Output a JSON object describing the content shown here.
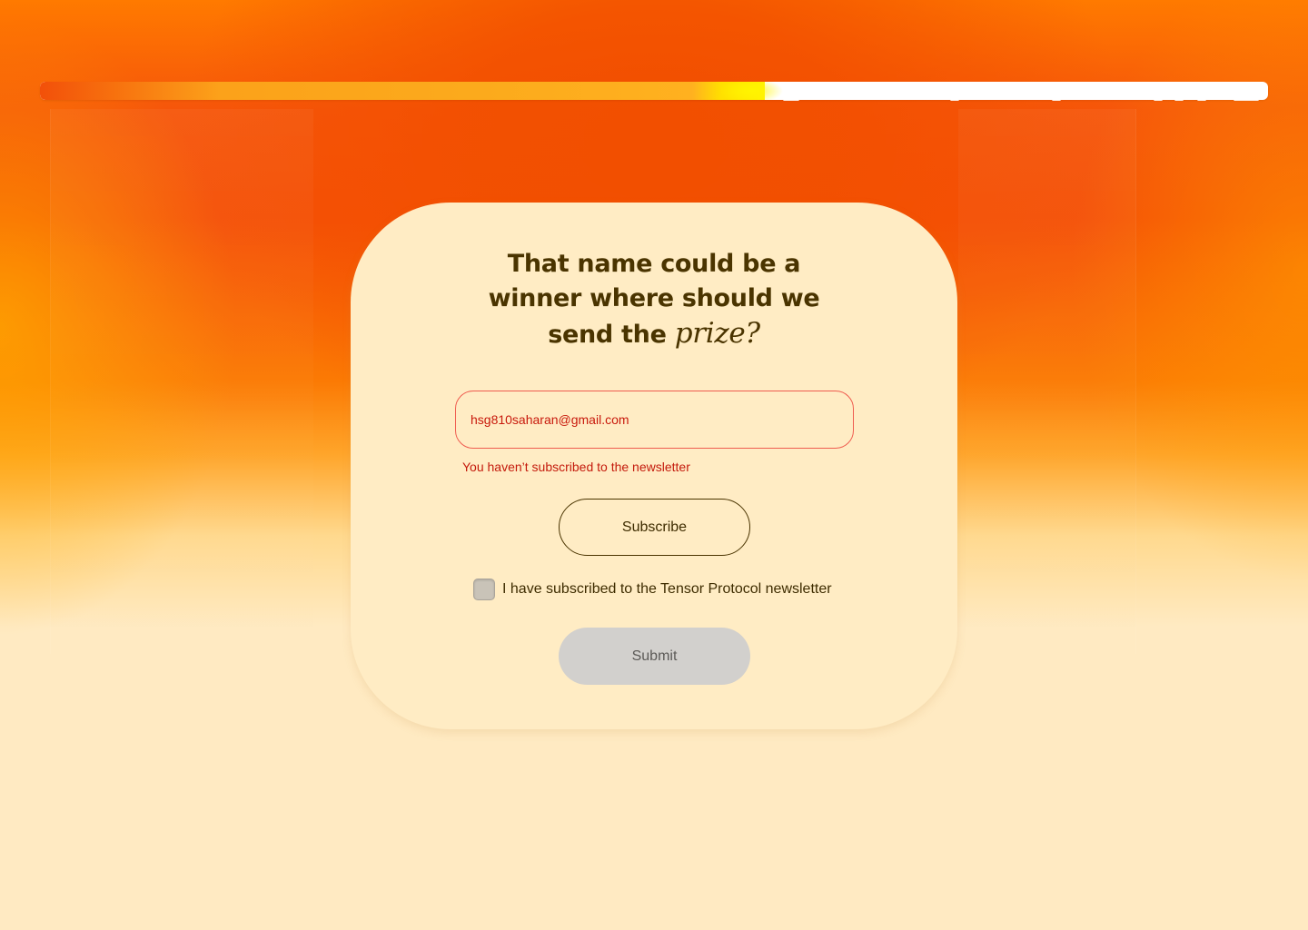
{
  "progress": {
    "value": 0.59
  },
  "heading": {
    "line1": "That name could be a",
    "line2": "winner where should we",
    "line3_prefix": "send the ",
    "line3_emphasis": "prize?"
  },
  "email": {
    "value": "hsg810saharan@gmail.com",
    "error": "You haven’t subscribed to the newsletter"
  },
  "subscribe_label": "Subscribe",
  "checkbox": {
    "label": "I have subscribed to the Tensor Protocol newsletter",
    "checked": false
  },
  "submit_label": "Submit",
  "colors": {
    "heading": "#4a3400",
    "error": "#c41a0c",
    "card": "#ffecc4",
    "accent": "#f55006"
  }
}
